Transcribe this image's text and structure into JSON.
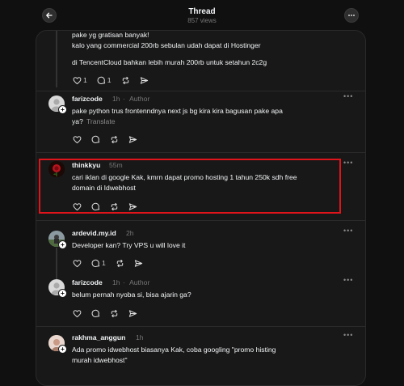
{
  "header": {
    "title": "Thread",
    "views": "857 views"
  },
  "icons": {
    "back": "arrow-left-icon",
    "menu": "more-horizontal-icon"
  },
  "posts": [
    {
      "id": "top-reply",
      "lines": [
        "pake yg gratisan banyak!",
        "kalo yang commercial 200rb sebulan udah dapat di Hostinger",
        "di TencentCloud bahkan lebih murah 200rb untuk setahun 2c2g"
      ],
      "likes": "1",
      "replies": "1"
    },
    {
      "id": "farizcode-1",
      "username": "farizcode",
      "time": "1h",
      "role": "Author",
      "lines": [
        "pake python trus frontenndnya next js bg kira kira bagusan pake apa",
        "ya?"
      ],
      "translate": "Translate"
    },
    {
      "id": "thinkkyu",
      "username": "thinkkyu",
      "time": "55m",
      "lines": [
        "cari iklan di google Kak, kmrn dapat promo hosting 1 tahun 250k sdh free",
        "domain di Idwebhost"
      ]
    },
    {
      "id": "ardevid",
      "username": "ardevid.my.id",
      "time": "2h",
      "lines": [
        "Developer kan? Try VPS u will love it"
      ],
      "replies": "1"
    },
    {
      "id": "farizcode-2",
      "username": "farizcode",
      "time": "1h",
      "role": "Author",
      "lines": [
        "belum pernah nyoba si, bisa ajarin ga?"
      ]
    },
    {
      "id": "rakhma",
      "username": "rakhma_anggun",
      "time": "1h",
      "lines": [
        "Ada promo idwebhost biasanya Kak, coba googling \"promo histing",
        "murah idwebhost\""
      ]
    }
  ],
  "colors": {
    "background": "#101010",
    "panel": "#181818",
    "highlight": "#e0141b",
    "text": "#f3f5f7",
    "muted": "#777777"
  }
}
